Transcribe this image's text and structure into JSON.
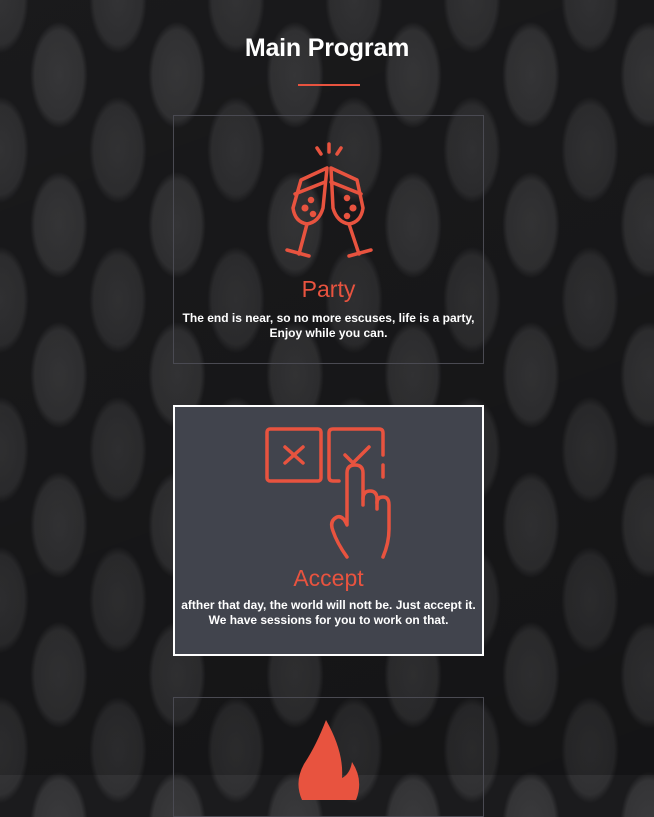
{
  "section": {
    "title": "Main Program"
  },
  "cards": [
    {
      "icon": "champagne-toast-icon",
      "title": "Party",
      "description_line1": "The end is near, so no more escuses, life is a party,",
      "description_line2": "Enjoy while you can."
    },
    {
      "icon": "accept-checkbox-hand-icon",
      "title": "Accept",
      "description_line1": "afther that day, the world will nott be. Just accept it.",
      "description_line2": "We have sessions for you to work on that."
    },
    {
      "icon": "flame-icon",
      "title": "",
      "description_line1": "",
      "description_line2": ""
    }
  ],
  "colors": {
    "accent": "#e8533f",
    "card_active_bg": "#41444d",
    "card_border": "#4a4a52"
  }
}
